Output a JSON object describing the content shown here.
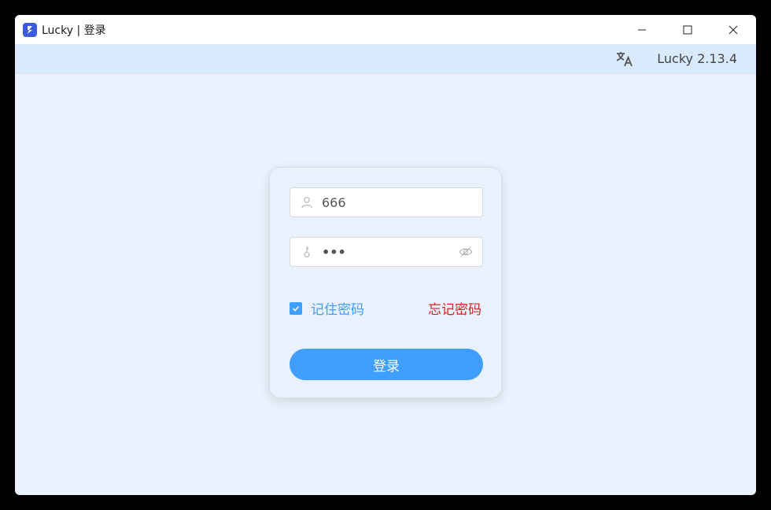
{
  "window": {
    "title": "Lucky | 登录"
  },
  "header": {
    "version": "Lucky 2.13.4",
    "translate_icon": "translate-icon"
  },
  "login": {
    "username_value": "666",
    "password_value": "•••",
    "remember_label": "记住密码",
    "remember_checked": true,
    "forgot_label": "忘记密码",
    "submit_label": "登录"
  },
  "colors": {
    "accent": "#409eff",
    "danger": "#e02020",
    "background": "#eaf3fd",
    "header": "#d8eafb"
  }
}
